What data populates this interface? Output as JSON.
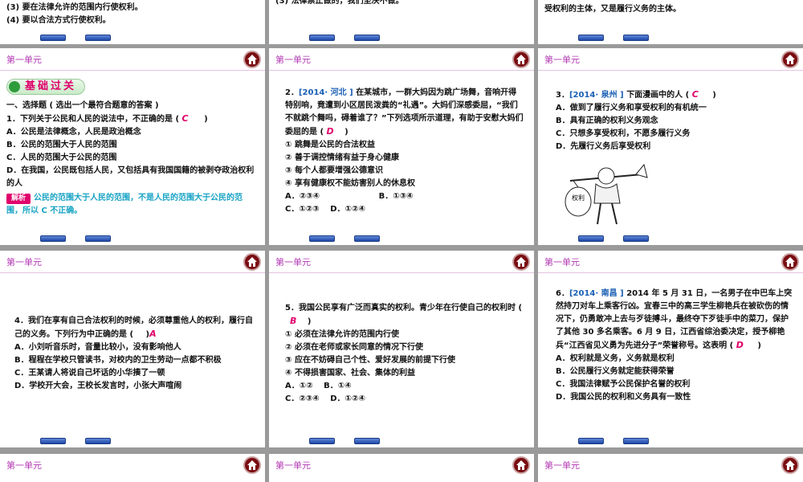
{
  "unit_label": "第一单元",
  "top": {
    "left": [
      "(3) 要在法律允许的范围内行使权利。",
      "(4) 要以合法方式行使权利。"
    ],
    "mid": [
      "(3) 法律禁止做的，我们坚决不做。"
    ],
    "right": [
      "受权利的主体，又是履行义务的主体。"
    ]
  },
  "s1": {
    "badge": "基础过关",
    "section": "一、选择题 ( 选出一个最符合题意的答案 )",
    "q": "1．下列关于公民和人民的说法中，不正确的是 (",
    "ans": "C",
    "q_end": ")",
    "opts": [
      "A．公民是法律概念，人民是政治概念",
      "B．公民的范围大于人民的范围",
      "C．人民的范围大于公民的范围",
      "D．在我国，公民既包括人民，又包括具有我国国籍的被剥夺政治权利的人"
    ],
    "jiexi_label": "解析",
    "jiexi": "公民的范围大于人民的范围，不是人民的范围大于公民的范围，所以 C 不正确。"
  },
  "s2": {
    "num": "2．",
    "tag": "[2014· 河北 ]",
    "q": "在某城市，一群大妈因为跳广场舞，音响开得特别响，竟遭到小区居民泼粪的“礼遇”。大妈们深感委屈，“我们不就跳个舞吗，碍着谁了？”下列选项所示道理，有助于安慰大妈们委屈的是 (",
    "ans": "D",
    "q_end": ")",
    "opts": [
      "① 跳舞是公民的合法权益",
      "② 善于调控情绪有益于身心健康",
      "③ 每个人都要增强公德意识",
      "④ 享有健康权不能妨害别人的休息权"
    ],
    "choices": [
      "A．②③④",
      "B．①③④",
      "C．①②③",
      "D．①②④"
    ]
  },
  "s3": {
    "num": "3．",
    "tag": "[2014· 泉州 ]",
    "q": "下面漫画中的人 (",
    "ans": "C",
    "q_end": ")",
    "opts": [
      "A．做到了履行义务和享受权利的有机统一",
      "B．具有正确的权利义务观念",
      "C．只想多享受权利，不愿多履行义务",
      "D．先履行义务后享受权利"
    ],
    "cartoon_bag": "权利"
  },
  "s4": {
    "q": "4．我们在享有自己合法权利的时候，必须尊重他人的权利，履行自己的义务。下列行为中正确的是 (",
    "ans": "A",
    "q_end": ")",
    "opts": [
      "A．小刘听音乐时，音量比较小，没有影响他人",
      "B．程程在学校只管读书，对校内的卫生劳动一点都不积极",
      "C．王某请人将说自己坏话的小华揍了一顿",
      "D．学校开大会，王校长发言时，小张大声喧闹"
    ]
  },
  "s5": {
    "q": "5．我国公民享有广泛而真实的权利。青少年在行使自己的权利时 (",
    "ans": "B",
    "q_end": ")",
    "opts": [
      "① 必须在法律允许的范围内行使",
      "② 必须在老师或家长同意的情况下行使",
      "③ 应在不妨碍自己个性、爱好发展的前提下行使",
      "④ 不得损害国家、社会、集体的利益"
    ],
    "choices": [
      "A．①②",
      "B．①④",
      "C．②③④",
      "D．①②④"
    ]
  },
  "s6": {
    "num": "6．",
    "tag": "[2014· 南昌 ]",
    "q": "2014 年 5 月 31 日，一名男子在中巴车上突然持刀对车上乘客行凶。宜春三中的高三学生柳艳兵在被砍伤的情况下，仍勇敢冲上去与歹徒搏斗，最终夺下歹徒手中的菜刀，保护了其他 30 多名乘客。6 月 9 日，江西省综治委决定，授予柳艳兵“江西省见义勇为先进分子”荣誉称号。这表明 (",
    "ans": "D",
    "q_end": ")",
    "opts": [
      "A．权利就是义务，义务就是权利",
      "B．公民履行义务就定能获得荣誉",
      "C．我国法律赋予公民保护名誉的权利",
      "D．我国公民的权利和义务具有一致性"
    ]
  }
}
